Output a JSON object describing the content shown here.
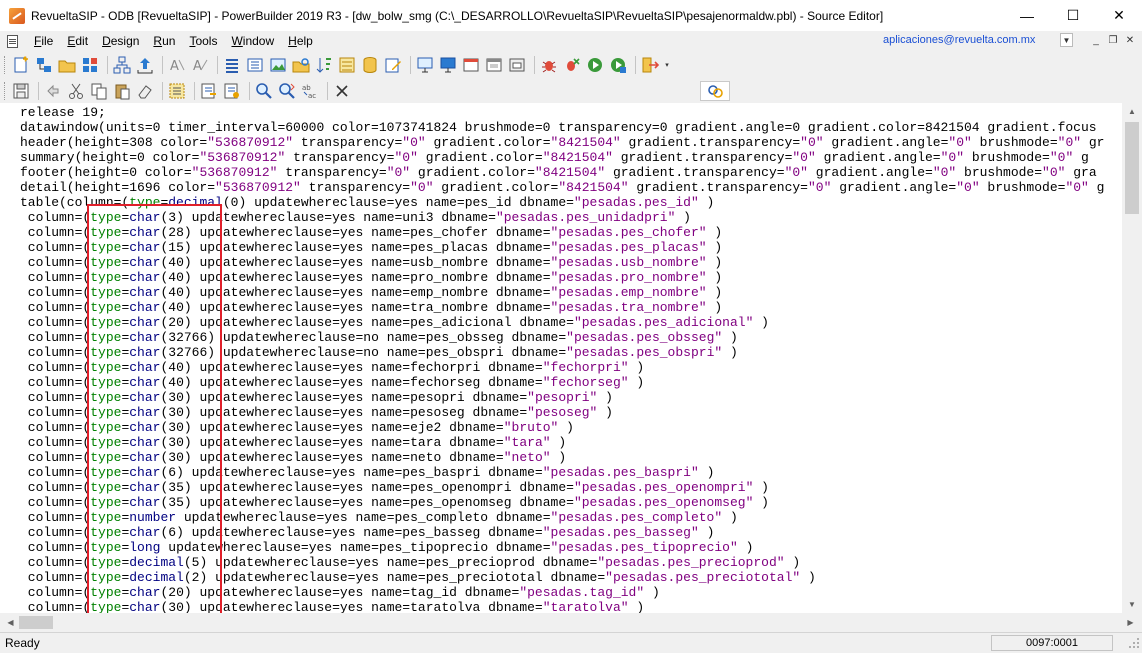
{
  "window": {
    "title": "RevueltaSIP - ODB [RevueltaSIP]  - PowerBuilder 2019 R3 - [dw_bolw_smg (C:\\_DESARROLLO\\RevueltaSIP\\RevueltaSIP\\pesajenormaldw.pbl) - Source Editor]",
    "minimize": "—",
    "maximize": "☐",
    "close": "✕"
  },
  "menubar": {
    "items": [
      {
        "u": "F",
        "rest": "ile"
      },
      {
        "u": "E",
        "rest": "dit"
      },
      {
        "u": "D",
        "pre": "",
        "rest": "esign"
      },
      {
        "u": "R",
        "rest": "un"
      },
      {
        "u": "T",
        "rest": "ools"
      },
      {
        "u": "W",
        "rest": "indow"
      },
      {
        "u": "H",
        "rest": "elp"
      }
    ],
    "user_email": "aplicaciones@revuelta.com.mx"
  },
  "editor": {
    "lines": [
      {
        "segs": [
          [
            "",
            "release 19;"
          ]
        ]
      },
      {
        "segs": [
          [
            "",
            "datawindow(units=0 timer_interval=60000 color=1073741824 brushmode=0 transparency=0 gradient.angle=0 gradient.color=8421504 gradient.focus"
          ]
        ]
      },
      {
        "segs": [
          [
            "",
            "header(height=308 color="
          ],
          [
            "st",
            "\"536870912\""
          ],
          [
            "",
            " transparency="
          ],
          [
            "st",
            "\"0\""
          ],
          [
            "",
            " gradient.color="
          ],
          [
            "st",
            "\"8421504\""
          ],
          [
            "",
            " gradient.transparency="
          ],
          [
            "st",
            "\"0\""
          ],
          [
            "",
            " gradient.angle="
          ],
          [
            "st",
            "\"0\""
          ],
          [
            "",
            " brushmode="
          ],
          [
            "st",
            "\"0\""
          ],
          [
            "",
            " gr"
          ]
        ]
      },
      {
        "segs": [
          [
            "",
            "summary(height=0 color="
          ],
          [
            "st",
            "\"536870912\""
          ],
          [
            "",
            " transparency="
          ],
          [
            "st",
            "\"0\""
          ],
          [
            "",
            " gradient.color="
          ],
          [
            "st",
            "\"8421504\""
          ],
          [
            "",
            " gradient.transparency="
          ],
          [
            "st",
            "\"0\""
          ],
          [
            "",
            " gradient.angle="
          ],
          [
            "st",
            "\"0\""
          ],
          [
            "",
            " brushmode="
          ],
          [
            "st",
            "\"0\""
          ],
          [
            "",
            " g"
          ]
        ]
      },
      {
        "segs": [
          [
            "",
            "footer(height=0 color="
          ],
          [
            "st",
            "\"536870912\""
          ],
          [
            "",
            " transparency="
          ],
          [
            "st",
            "\"0\""
          ],
          [
            "",
            " gradient.color="
          ],
          [
            "st",
            "\"8421504\""
          ],
          [
            "",
            " gradient.transparency="
          ],
          [
            "st",
            "\"0\""
          ],
          [
            "",
            " gradient.angle="
          ],
          [
            "st",
            "\"0\""
          ],
          [
            "",
            " brushmode="
          ],
          [
            "st",
            "\"0\""
          ],
          [
            "",
            " gra"
          ]
        ]
      },
      {
        "segs": [
          [
            "",
            "detail(height=1696 color="
          ],
          [
            "st",
            "\"536870912\""
          ],
          [
            "",
            " transparency="
          ],
          [
            "st",
            "\"0\""
          ],
          [
            "",
            " gradient.color="
          ],
          [
            "st",
            "\"8421504\""
          ],
          [
            "",
            " gradient.transparency="
          ],
          [
            "st",
            "\"0\""
          ],
          [
            "",
            " gradient.angle="
          ],
          [
            "st",
            "\"0\""
          ],
          [
            "",
            " brushmode="
          ],
          [
            "st",
            "\"0\""
          ],
          [
            "",
            " g"
          ]
        ]
      },
      {
        "segs": [
          [
            "",
            "table(column=("
          ],
          [
            "kw",
            "type"
          ],
          [
            "",
            "="
          ],
          [
            "ty",
            "decimal"
          ],
          [
            "",
            "(0) updatewhereclause=yes name=pes_id dbname="
          ],
          [
            "st",
            "\"pesadas.pes_id\""
          ],
          [
            "",
            " )"
          ]
        ]
      },
      {
        "segs": [
          [
            "",
            " column=("
          ],
          [
            "kw",
            "type"
          ],
          [
            "",
            "="
          ],
          [
            "ty",
            "char"
          ],
          [
            "",
            "(3) updatewhereclause=yes name=uni3 dbname="
          ],
          [
            "st",
            "\"pesadas.pes_unidadpri\""
          ],
          [
            "",
            " )"
          ]
        ]
      },
      {
        "segs": [
          [
            "",
            " column=("
          ],
          [
            "kw",
            "type"
          ],
          [
            "",
            "="
          ],
          [
            "ty",
            "char"
          ],
          [
            "",
            "(28) updatewhereclause=yes name=pes_chofer dbname="
          ],
          [
            "st",
            "\"pesadas.pes_chofer\""
          ],
          [
            "",
            " )"
          ]
        ]
      },
      {
        "segs": [
          [
            "",
            " column=("
          ],
          [
            "kw",
            "type"
          ],
          [
            "",
            "="
          ],
          [
            "ty",
            "char"
          ],
          [
            "",
            "(15) updatewhereclause=yes name=pes_placas dbname="
          ],
          [
            "st",
            "\"pesadas.pes_placas\""
          ],
          [
            "",
            " )"
          ]
        ]
      },
      {
        "segs": [
          [
            "",
            " column=("
          ],
          [
            "kw",
            "type"
          ],
          [
            "",
            "="
          ],
          [
            "ty",
            "char"
          ],
          [
            "",
            "(40) updatewhereclause=yes name=usb_nombre dbname="
          ],
          [
            "st",
            "\"pesadas.usb_nombre\""
          ],
          [
            "",
            " )"
          ]
        ]
      },
      {
        "segs": [
          [
            "",
            " column=("
          ],
          [
            "kw",
            "type"
          ],
          [
            "",
            "="
          ],
          [
            "ty",
            "char"
          ],
          [
            "",
            "(40) updatewhereclause=yes name=pro_nombre dbname="
          ],
          [
            "st",
            "\"pesadas.pro_nombre\""
          ],
          [
            "",
            " )"
          ]
        ]
      },
      {
        "segs": [
          [
            "",
            " column=("
          ],
          [
            "kw",
            "type"
          ],
          [
            "",
            "="
          ],
          [
            "ty",
            "char"
          ],
          [
            "",
            "(40) updatewhereclause=yes name=emp_nombre dbname="
          ],
          [
            "st",
            "\"pesadas.emp_nombre\""
          ],
          [
            "",
            " )"
          ]
        ]
      },
      {
        "segs": [
          [
            "",
            " column=("
          ],
          [
            "kw",
            "type"
          ],
          [
            "",
            "="
          ],
          [
            "ty",
            "char"
          ],
          [
            "",
            "(40) updatewhereclause=yes name=tra_nombre dbname="
          ],
          [
            "st",
            "\"pesadas.tra_nombre\""
          ],
          [
            "",
            " )"
          ]
        ]
      },
      {
        "segs": [
          [
            "",
            " column=("
          ],
          [
            "kw",
            "type"
          ],
          [
            "",
            "="
          ],
          [
            "ty",
            "char"
          ],
          [
            "",
            "(20) updatewhereclause=yes name=pes_adicional dbname="
          ],
          [
            "st",
            "\"pesadas.pes_adicional\""
          ],
          [
            "",
            " )"
          ]
        ]
      },
      {
        "segs": [
          [
            "",
            " column=("
          ],
          [
            "kw",
            "type"
          ],
          [
            "",
            "="
          ],
          [
            "ty",
            "char"
          ],
          [
            "",
            "(32766) updatewhereclause=no name=pes_obsseg dbname="
          ],
          [
            "st",
            "\"pesadas.pes_obsseg\""
          ],
          [
            "",
            " )"
          ]
        ]
      },
      {
        "segs": [
          [
            "",
            " column=("
          ],
          [
            "kw",
            "type"
          ],
          [
            "",
            "="
          ],
          [
            "ty",
            "char"
          ],
          [
            "",
            "(32766) updatewhereclause=no name=pes_obspri dbname="
          ],
          [
            "st",
            "\"pesadas.pes_obspri\""
          ],
          [
            "",
            " )"
          ]
        ]
      },
      {
        "segs": [
          [
            "",
            " column=("
          ],
          [
            "kw",
            "type"
          ],
          [
            "",
            "="
          ],
          [
            "ty",
            "char"
          ],
          [
            "",
            "(40) updatewhereclause=yes name=fechorpri dbname="
          ],
          [
            "st",
            "\"fechorpri\""
          ],
          [
            "",
            " )"
          ]
        ]
      },
      {
        "segs": [
          [
            "",
            " column=("
          ],
          [
            "kw",
            "type"
          ],
          [
            "",
            "="
          ],
          [
            "ty",
            "char"
          ],
          [
            "",
            "(40) updatewhereclause=yes name=fechorseg dbname="
          ],
          [
            "st",
            "\"fechorseg\""
          ],
          [
            "",
            " )"
          ]
        ]
      },
      {
        "segs": [
          [
            "",
            " column=("
          ],
          [
            "kw",
            "type"
          ],
          [
            "",
            "="
          ],
          [
            "ty",
            "char"
          ],
          [
            "",
            "(30) updatewhereclause=yes name=pesopri dbname="
          ],
          [
            "st",
            "\"pesopri\""
          ],
          [
            "",
            " )"
          ]
        ]
      },
      {
        "segs": [
          [
            "",
            " column=("
          ],
          [
            "kw",
            "type"
          ],
          [
            "",
            "="
          ],
          [
            "ty",
            "char"
          ],
          [
            "",
            "(30) updatewhereclause=yes name=pesoseg dbname="
          ],
          [
            "st",
            "\"pesoseg\""
          ],
          [
            "",
            " )"
          ]
        ]
      },
      {
        "segs": [
          [
            "",
            " column=("
          ],
          [
            "kw",
            "type"
          ],
          [
            "",
            "="
          ],
          [
            "ty",
            "char"
          ],
          [
            "",
            "(30) updatewhereclause=yes name=eje2 dbname="
          ],
          [
            "st",
            "\"bruto\""
          ],
          [
            "",
            " )"
          ]
        ]
      },
      {
        "segs": [
          [
            "",
            " column=("
          ],
          [
            "kw",
            "type"
          ],
          [
            "",
            "="
          ],
          [
            "ty",
            "char"
          ],
          [
            "",
            "(30) updatewhereclause=yes name=tara dbname="
          ],
          [
            "st",
            "\"tara\""
          ],
          [
            "",
            " )"
          ]
        ]
      },
      {
        "segs": [
          [
            "",
            " column=("
          ],
          [
            "kw",
            "type"
          ],
          [
            "",
            "="
          ],
          [
            "ty",
            "char"
          ],
          [
            "",
            "(30) updatewhereclause=yes name=neto dbname="
          ],
          [
            "st",
            "\"neto\""
          ],
          [
            "",
            " )"
          ]
        ]
      },
      {
        "segs": [
          [
            "",
            " column=("
          ],
          [
            "kw",
            "type"
          ],
          [
            "",
            "="
          ],
          [
            "ty",
            "char"
          ],
          [
            "",
            "(6) updatewhereclause=yes name=pes_baspri dbname="
          ],
          [
            "st",
            "\"pesadas.pes_baspri\""
          ],
          [
            "",
            " )"
          ]
        ]
      },
      {
        "segs": [
          [
            "",
            " column=("
          ],
          [
            "kw",
            "type"
          ],
          [
            "",
            "="
          ],
          [
            "ty",
            "char"
          ],
          [
            "",
            "(35) updatewhereclause=yes name=pes_openompri dbname="
          ],
          [
            "st",
            "\"pesadas.pes_openompri\""
          ],
          [
            "",
            " )"
          ]
        ]
      },
      {
        "segs": [
          [
            "",
            " column=("
          ],
          [
            "kw",
            "type"
          ],
          [
            "",
            "="
          ],
          [
            "ty",
            "char"
          ],
          [
            "",
            "(35) updatewhereclause=yes name=pes_openomseg dbname="
          ],
          [
            "st",
            "\"pesadas.pes_openomseg\""
          ],
          [
            "",
            " )"
          ]
        ]
      },
      {
        "segs": [
          [
            "",
            " column=("
          ],
          [
            "kw",
            "type"
          ],
          [
            "",
            "="
          ],
          [
            "ty",
            "number"
          ],
          [
            "",
            " updatewhereclause=yes name=pes_completo dbname="
          ],
          [
            "st",
            "\"pesadas.pes_completo\""
          ],
          [
            "",
            " )"
          ]
        ]
      },
      {
        "segs": [
          [
            "",
            " column=("
          ],
          [
            "kw",
            "type"
          ],
          [
            "",
            "="
          ],
          [
            "ty",
            "char"
          ],
          [
            "",
            "(6) updatewhereclause=yes name=pes_basseg dbname="
          ],
          [
            "st",
            "\"pesadas.pes_basseg\""
          ],
          [
            "",
            " )"
          ]
        ]
      },
      {
        "segs": [
          [
            "",
            " column=("
          ],
          [
            "kw",
            "type"
          ],
          [
            "",
            "="
          ],
          [
            "ty",
            "long"
          ],
          [
            "",
            " updatewhereclause=yes name=pes_tipoprecio dbname="
          ],
          [
            "st",
            "\"pesadas.pes_tipoprecio\""
          ],
          [
            "",
            " )"
          ]
        ]
      },
      {
        "segs": [
          [
            "",
            " column=("
          ],
          [
            "kw",
            "type"
          ],
          [
            "",
            "="
          ],
          [
            "ty",
            "decimal"
          ],
          [
            "",
            "(5) updatewhereclause=yes name=pes_precioprod dbname="
          ],
          [
            "st",
            "\"pesadas.pes_precioprod\""
          ],
          [
            "",
            " )"
          ]
        ]
      },
      {
        "segs": [
          [
            "",
            " column=("
          ],
          [
            "kw",
            "type"
          ],
          [
            "",
            "="
          ],
          [
            "ty",
            "decimal"
          ],
          [
            "",
            "(2) updatewhereclause=yes name=pes_preciototal dbname="
          ],
          [
            "st",
            "\"pesadas.pes_preciototal\""
          ],
          [
            "",
            " )"
          ]
        ]
      },
      {
        "segs": [
          [
            "",
            " column=("
          ],
          [
            "kw",
            "type"
          ],
          [
            "",
            "="
          ],
          [
            "ty",
            "char"
          ],
          [
            "",
            "(20) updatewhereclause=yes name=tag_id dbname="
          ],
          [
            "st",
            "\"pesadas.tag_id\""
          ],
          [
            "",
            " )"
          ]
        ]
      },
      {
        "segs": [
          [
            "",
            " column=("
          ],
          [
            "kw",
            "type"
          ],
          [
            "",
            "="
          ],
          [
            "ty",
            "char"
          ],
          [
            "",
            "(30) updatewhereclause=yes name=taratolva dbname="
          ],
          [
            "st",
            "\"taratolva\""
          ],
          [
            "",
            " )"
          ]
        ]
      }
    ]
  },
  "statusbar": {
    "status": "Ready",
    "position": "0097:0001"
  },
  "colors": {
    "keyword": "#008000",
    "type": "#000080",
    "string": "#800080",
    "highlight": "#e0202a"
  }
}
